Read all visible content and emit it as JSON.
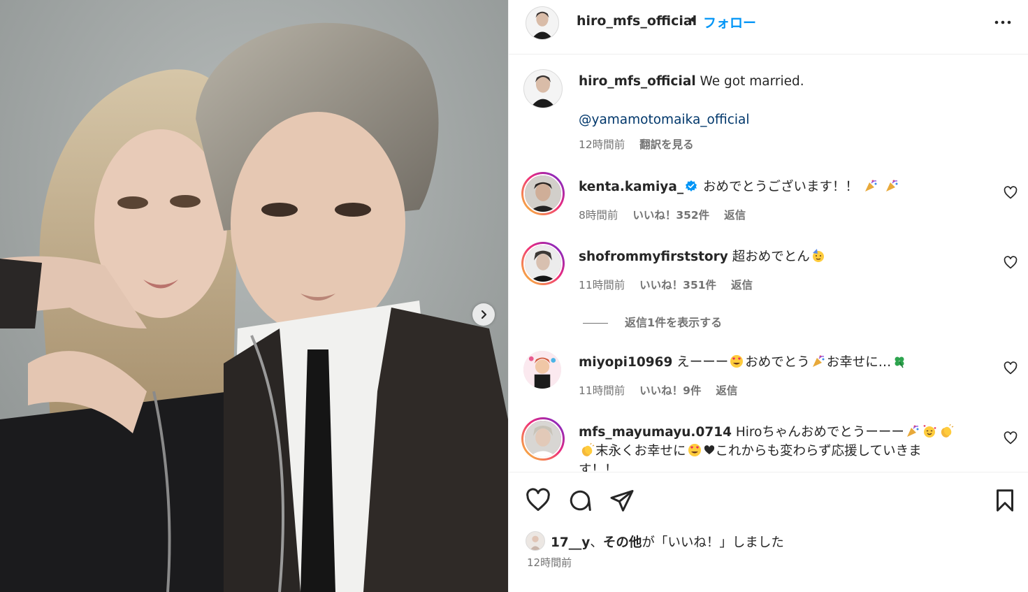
{
  "header": {
    "username": "hiro_mfs_official",
    "separator": "•",
    "follow_label": "フォロー",
    "more_icon": "more-horizontal-icon"
  },
  "caption": {
    "username": "hiro_mfs_official",
    "text": "We got married.",
    "mention": "@yamamotomaika_official",
    "time": "12時間前",
    "translate": "翻訳を見る"
  },
  "comments": [
    {
      "username": "kenta.kamiya_",
      "verified": true,
      "text": "おめでとうございます！！",
      "emoji": [
        "party-popper",
        "party-popper"
      ],
      "time": "8時間前",
      "likes": "いいね！352件",
      "reply": "返信"
    },
    {
      "username": "shofrommyfirststory",
      "text": "超おめでとん",
      "emoji": [
        "partying-face"
      ],
      "time": "11時間前",
      "likes": "いいね！351件",
      "reply": "返信"
    },
    {
      "username": "miyopi10969",
      "text_parts": [
        "えーーー",
        "おめでとう",
        "お幸せに…"
      ],
      "emoji": [
        "heart-eyes",
        "party-popper",
        "four-leaf-clover"
      ],
      "time": "11時間前",
      "likes": "いいね！9件",
      "reply": "返信"
    },
    {
      "username": "mfs_mayumayu.0714",
      "text_parts": [
        "Hiroちゃんおめでとうーーー",
        "末永くお幸せに",
        "これからも変わらず応援していきま",
        "す！！"
      ],
      "emoji": [
        "party-popper",
        "smiling-hearts",
        "clapping-hands",
        "clapping-hands",
        "heart-eyes",
        "black-heart"
      ]
    }
  ],
  "view_replies": "返信1件を表示する",
  "actions": {
    "icons": [
      "heart-icon",
      "comment-icon",
      "share-icon",
      "bookmark-icon"
    ],
    "liked_by_user": "17__y",
    "liked_by_sep": "、",
    "liked_by_others": "その他",
    "liked_by_suffix": "が「いいね！」しました",
    "time": "12時間前"
  },
  "photo": {
    "next_icon": "chevron-right-icon"
  },
  "colors": {
    "accent": "#0095f6",
    "text": "#262626",
    "muted": "#737373",
    "mention": "#00376b"
  }
}
